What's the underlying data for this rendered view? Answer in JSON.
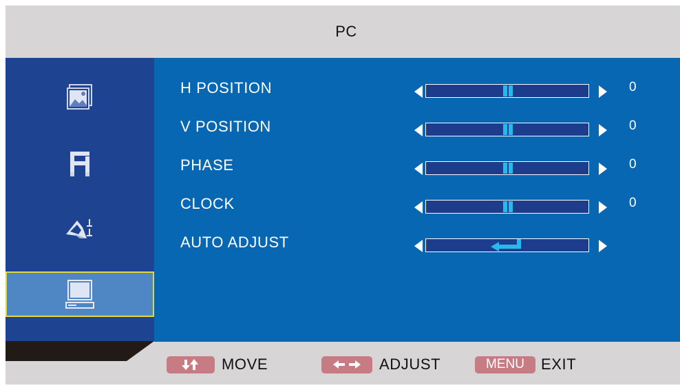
{
  "osd": {
    "title": "PC"
  },
  "sidebar": {
    "items": [
      {
        "name": "picture",
        "icon": "picture-icon",
        "selected": false
      },
      {
        "name": "audio",
        "icon": "audio-icon",
        "selected": false
      },
      {
        "name": "setup",
        "icon": "setup-icon",
        "selected": false
      },
      {
        "name": "pc",
        "icon": "monitor-icon",
        "selected": true
      }
    ]
  },
  "settings": [
    {
      "label": "H POSITION",
      "value": "0",
      "level": 0.5
    },
    {
      "label": "V POSITION",
      "value": "0",
      "level": 0.5
    },
    {
      "label": "PHASE",
      "value": "0",
      "level": 0.5
    },
    {
      "label": "CLOCK",
      "value": "0",
      "level": 0.5
    },
    {
      "label": "AUTO ADJUST",
      "action_icon": "enter-icon"
    }
  ],
  "footer": {
    "move_label": "MOVE",
    "adjust_label": "ADJUST",
    "menu_key": "MENU",
    "exit_label": "EXIT",
    "move_icon": "up-down-arrows-icon",
    "adjust_icon": "left-right-arrows-icon"
  },
  "colors": {
    "background": "#d8d5d6",
    "sidebar": "#1e4390",
    "content": "#0767b3",
    "selected": "#4f86c4",
    "selection_border": "#e7d935",
    "slider_thumb": "#27b8ec",
    "key_badge": "#c77c83"
  }
}
